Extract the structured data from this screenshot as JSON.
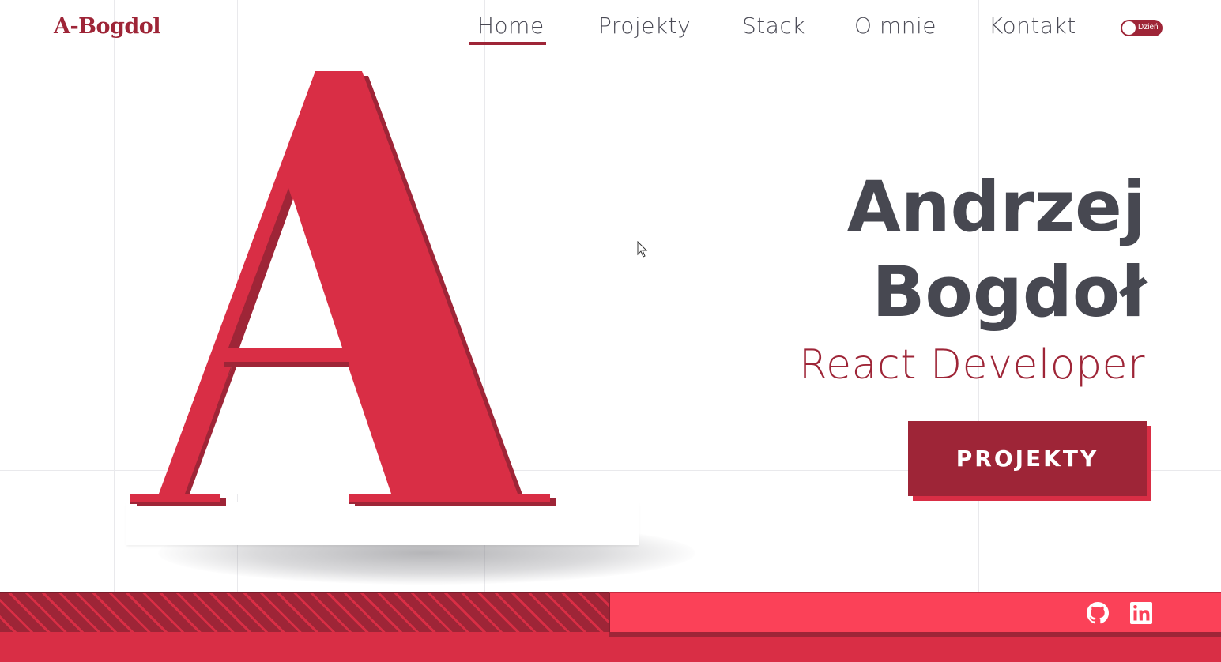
{
  "header": {
    "logo": "A-Bogdol",
    "nav": [
      {
        "label": "Home",
        "active": true
      },
      {
        "label": "Projekty",
        "active": false
      },
      {
        "label": "Stack",
        "active": false
      },
      {
        "label": "O mnie",
        "active": false
      },
      {
        "label": "Kontakt",
        "active": false
      }
    ],
    "theme_toggle": {
      "label": "Dzień"
    }
  },
  "hero": {
    "letter": "A",
    "first_name": "Andrzej",
    "last_name": "Bogdoł",
    "role": "React Developer",
    "cta_label": "PROJEKTY"
  },
  "footer": {
    "social": [
      {
        "name": "github-icon"
      },
      {
        "name": "linkedin-icon"
      }
    ]
  },
  "colors": {
    "brand_dark": "#9e2537",
    "brand_red": "#d92e45",
    "brand_light": "#fb4158",
    "text_dark": "#474851"
  }
}
